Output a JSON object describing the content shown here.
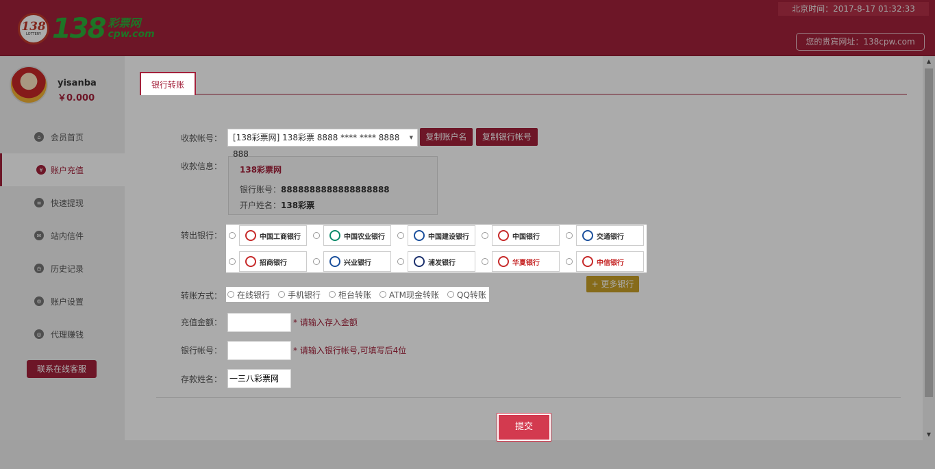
{
  "header": {
    "logo_badge": "138",
    "logo_badge_sub": "LOTTERY",
    "logo_big": "138",
    "logo_cn": "彩票网",
    "logo_en": "cpw.com",
    "time": "北京时间：2017-8-17 01:32:33",
    "vip": "您的贵宾网址：138cpw.com"
  },
  "user": {
    "name": "yisanba",
    "balance": "￥0.000"
  },
  "menu": [
    {
      "label": "会员首页",
      "icon": "home-icon",
      "active": false
    },
    {
      "label": "账户充值",
      "icon": "deposit-icon",
      "active": true
    },
    {
      "label": "快速提现",
      "icon": "withdraw-icon",
      "active": false
    },
    {
      "label": "站内信件",
      "icon": "mail-icon",
      "active": false
    },
    {
      "label": "历史记录",
      "icon": "history-icon",
      "active": false
    },
    {
      "label": "账户设置",
      "icon": "settings-icon",
      "active": false
    },
    {
      "label": "代理赚钱",
      "icon": "agent-icon",
      "active": false
    }
  ],
  "contact_button": "联系在线客服",
  "tab": "银行转账",
  "form": {
    "account_label": "收款帐号：",
    "account_value": "[138彩票网] 138彩票 8888 **** **** 8888 888",
    "copy_name": "复制账户名",
    "copy_account": "复制银行帐号",
    "info_label": "收款信息：",
    "info_title": "138彩票网",
    "bank_account_label": "银行账号：",
    "bank_account_value": "8888888888888888888",
    "holder_label": "开户姓名：",
    "holder_value": "138彩票",
    "out_bank_label": "转出银行：",
    "banks": [
      "中国工商银行",
      "中国农业银行",
      "中国建设银行",
      "中国银行",
      "交通银行",
      "招商银行",
      "兴业银行",
      "浦发银行",
      "华夏银行",
      "中信银行"
    ],
    "more_banks": "+ 更多银行",
    "method_label": "转账方式：",
    "methods": [
      "在线银行",
      "手机银行",
      "柜台转账",
      "ATM现金转账",
      "QQ转账"
    ],
    "amount_label": "充值金额：",
    "amount_hint": "* 请输入存入金额",
    "bankno_label": "银行帐号：",
    "bankno_hint": "* 请输入银行帐号,可填写后4位",
    "depositor_label": "存款姓名：",
    "depositor_value": "一三八彩票网",
    "submit": "提交"
  },
  "colors": {
    "brand": "#a3213b",
    "more": "#c8a028",
    "submit": "#d33a4f"
  }
}
